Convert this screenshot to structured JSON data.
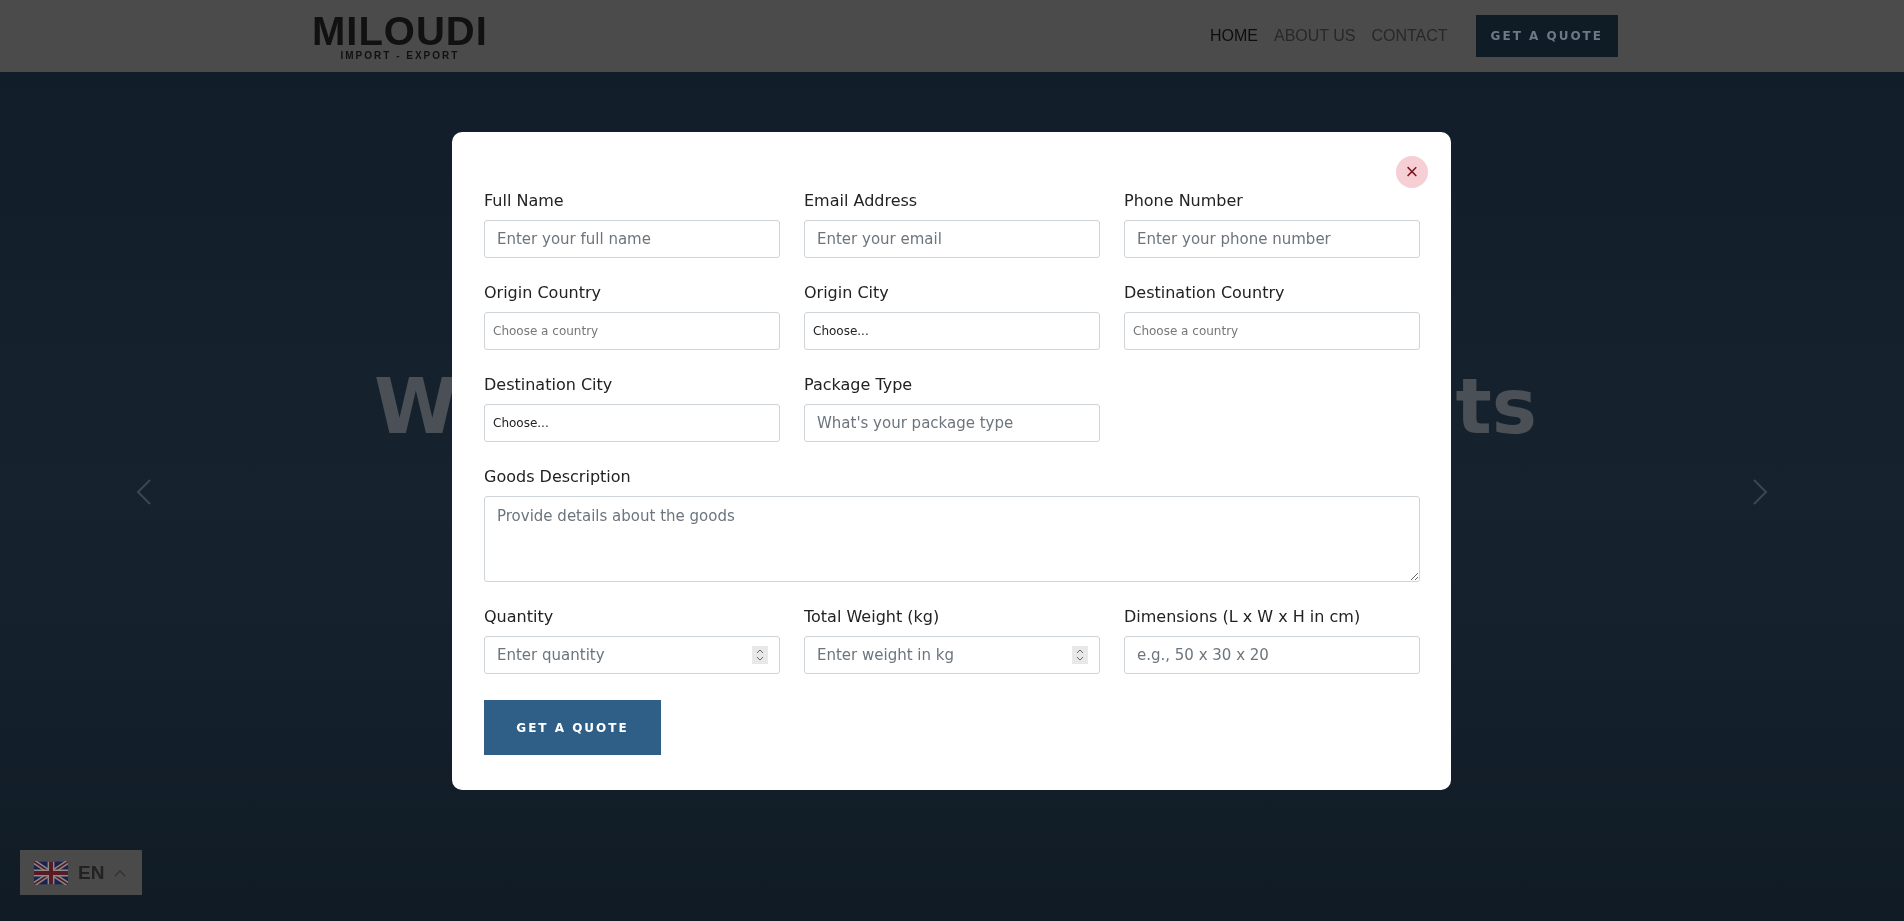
{
  "header": {
    "logo": {
      "name": "MILOUDI",
      "tagline": "IMPORT - EXPORT"
    },
    "nav": [
      {
        "label": "HOME",
        "selected": true
      },
      {
        "label": "ABOUT US",
        "selected": false
      },
      {
        "label": "CONTACT",
        "selected": false
      }
    ],
    "cta": "GET A QUOTE"
  },
  "hero": {
    "heading_visible_left": "W",
    "heading_visible_right": "ts"
  },
  "language": {
    "code": "EN"
  },
  "modal": {
    "close": "×",
    "fields": [
      {
        "kind": "text",
        "label": "Full Name",
        "placeholder": "Enter your full name"
      },
      {
        "kind": "text",
        "label": "Email Address",
        "placeholder": "Enter your email"
      },
      {
        "kind": "text",
        "label": "Phone Number",
        "placeholder": "Enter your phone number"
      },
      {
        "kind": "select",
        "label": "Origin Country",
        "placeholder": "Choose a country"
      },
      {
        "kind": "select",
        "label": "Origin City",
        "value": "Choose..."
      },
      {
        "kind": "select",
        "label": "Destination Country",
        "placeholder": "Choose a country"
      },
      {
        "kind": "select",
        "label": "Destination City",
        "value": "Choose..."
      },
      {
        "kind": "text",
        "label": "Package Type",
        "placeholder": "What's your package type"
      },
      {
        "kind": "textarea",
        "label": "Goods Description",
        "placeholder": "Provide details about the goods"
      },
      {
        "kind": "number",
        "label": "Quantity",
        "placeholder": "Enter quantity"
      },
      {
        "kind": "number",
        "label": "Total Weight (kg)",
        "placeholder": "Enter weight in kg"
      },
      {
        "kind": "text",
        "label": "Dimensions (L x W x H in cm)",
        "placeholder": "e.g., 50 x 30 x 20"
      }
    ],
    "submit": "GET A QUOTE"
  }
}
